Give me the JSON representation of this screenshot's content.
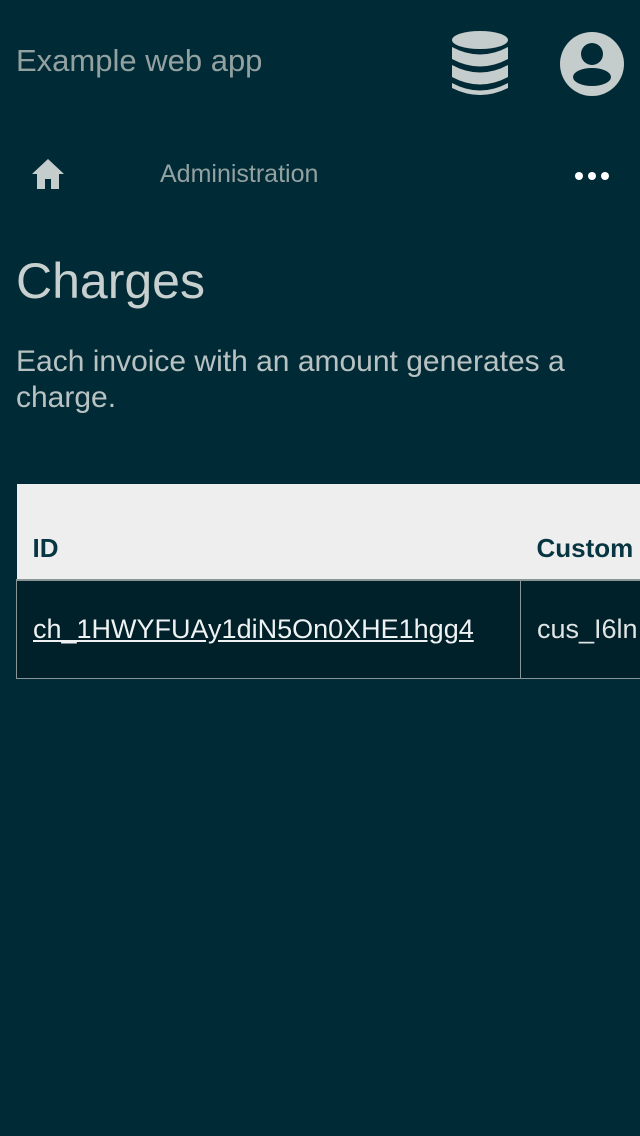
{
  "header": {
    "app_title": "Example web app",
    "icons": {
      "database": "database-icon",
      "account": "account-circle-icon"
    }
  },
  "nav": {
    "home_icon": "home-icon",
    "administration_label": "Administration",
    "more_icon": "more-horizontal-icon"
  },
  "main": {
    "title": "Charges",
    "description": "Each invoice with an amount generates a charge."
  },
  "table": {
    "columns": [
      "ID",
      "Custom"
    ],
    "rows": [
      {
        "id": "ch_1HWYFUAy1diN5On0XHE1hgg4",
        "customer": "cus_I6ln"
      }
    ]
  },
  "colors": {
    "background": "#002b36",
    "muted_text": "#93a1a1",
    "header_row": "#eeeeee",
    "row_background": "#00202a"
  }
}
